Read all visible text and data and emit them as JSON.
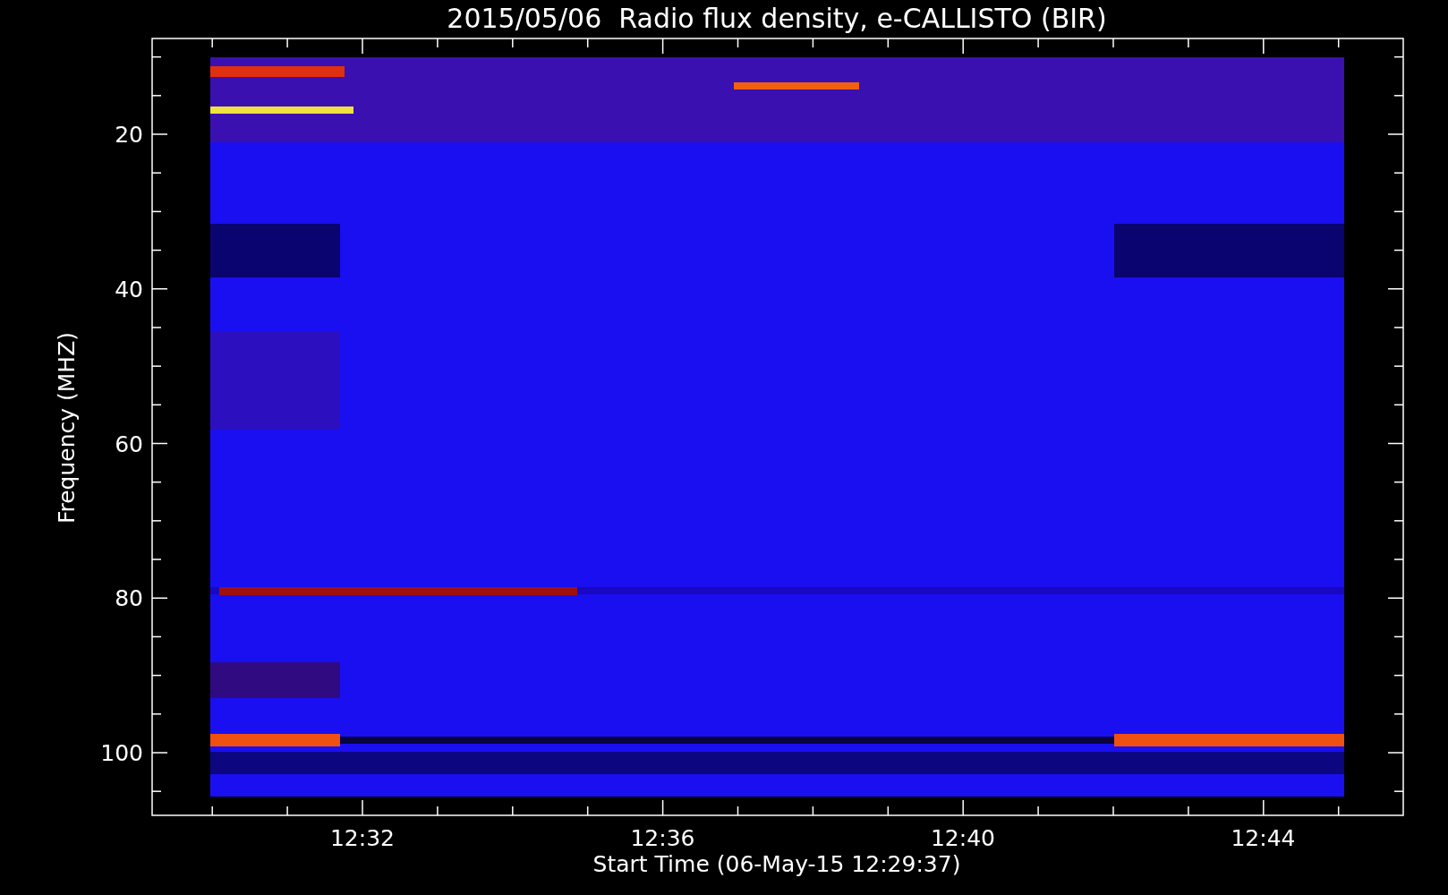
{
  "title": "2015/05/06  Radio flux density, e-CALLISTO (BIR)",
  "y_axis": {
    "label": "Frequency (MHZ)",
    "ticks": [
      "20",
      "40",
      "60",
      "80",
      "100"
    ]
  },
  "x_axis": {
    "label": "Start Time (06-May-15 12:29:37)",
    "ticks": [
      "12:32",
      "12:36",
      "12:40",
      "12:44"
    ]
  }
}
